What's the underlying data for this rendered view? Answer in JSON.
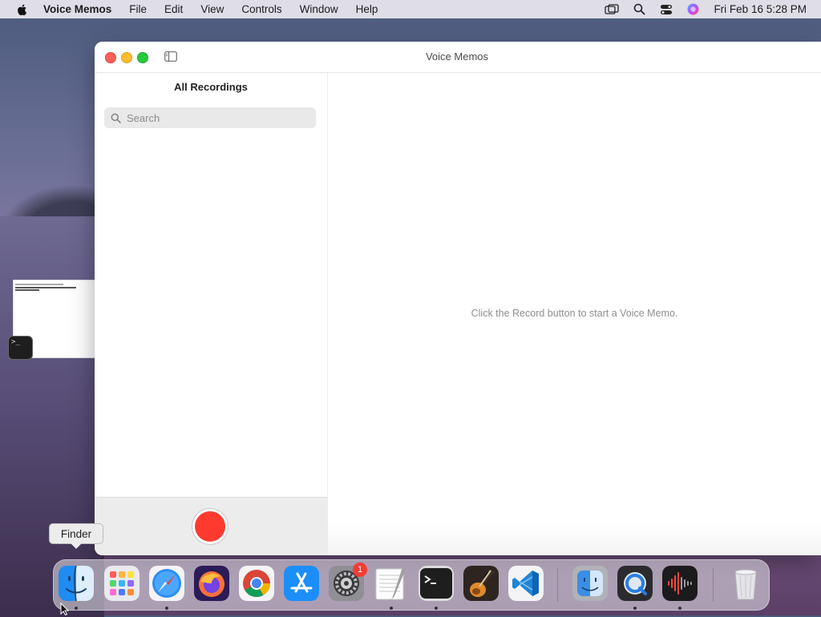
{
  "menubar": {
    "app_name": "Voice Memos",
    "items": [
      "File",
      "Edit",
      "View",
      "Controls",
      "Window",
      "Help"
    ],
    "clock": "Fri Feb 16  5:28 PM"
  },
  "window": {
    "title": "Voice Memos",
    "sidebar_title": "All Recordings",
    "search_placeholder": "Search",
    "empty_message": "Click the Record button to start a Voice Memo."
  },
  "tooltip": {
    "text": "Finder"
  },
  "dock": {
    "items": [
      {
        "name": "Finder",
        "icon": "finder-icon",
        "running": true
      },
      {
        "name": "Launchpad",
        "icon": "launchpad-icon",
        "running": false
      },
      {
        "name": "Safari",
        "icon": "safari-icon",
        "running": true
      },
      {
        "name": "Firefox",
        "icon": "firefox-icon",
        "running": false
      },
      {
        "name": "Chrome",
        "icon": "chrome-icon",
        "running": false
      },
      {
        "name": "App Store",
        "icon": "app-store-icon",
        "running": false
      },
      {
        "name": "System Settings",
        "icon": "system-settings-icon",
        "running": false,
        "badge": "1"
      },
      {
        "name": "TextEdit",
        "icon": "textedit-icon",
        "running": true
      },
      {
        "name": "Terminal",
        "icon": "terminal-icon",
        "running": true
      },
      {
        "name": "GarageBand",
        "icon": "garageband-icon",
        "running": false
      },
      {
        "name": "VS Code",
        "icon": "vscode-icon",
        "running": false
      },
      {
        "name": "Finder (2)",
        "icon": "finder-icon",
        "running": false
      },
      {
        "name": "QuickTime",
        "icon": "quicktime-icon",
        "running": true
      },
      {
        "name": "Voice Memos",
        "icon": "voice-memos-icon",
        "running": true
      },
      {
        "name": "Trash",
        "icon": "trash-icon",
        "running": false
      }
    ]
  },
  "colors": {
    "record": "#fe3a2f",
    "close": "#fe5f57",
    "minimize": "#febc2e",
    "zoom": "#28c840"
  }
}
